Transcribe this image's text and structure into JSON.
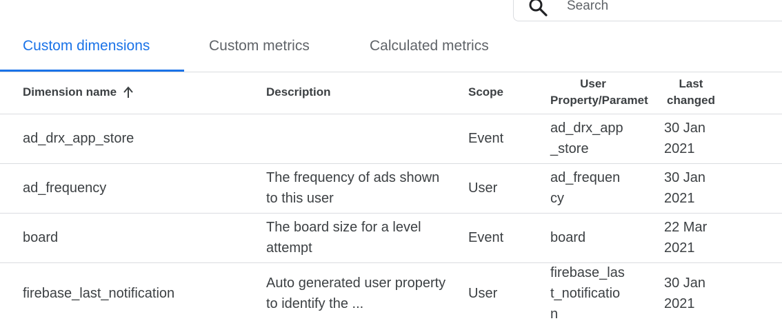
{
  "search": {
    "placeholder": "Search",
    "icon": "search-icon"
  },
  "colors": {
    "accent": "#1a73e8",
    "text": "#3c4043",
    "muted": "#5f6368",
    "divider": "#dadce0"
  },
  "tabs": [
    {
      "label": "Custom dimensions",
      "active": true
    },
    {
      "label": "Custom metrics",
      "active": false
    },
    {
      "label": "Calculated metrics",
      "active": false
    }
  ],
  "table": {
    "headers": {
      "name": "Dimension name",
      "sort_icon": "arrow-up-icon",
      "description": "Description",
      "scope": "Scope",
      "param_line1": "User",
      "param_line2": "Property/Parameter",
      "changed_line1": "Last",
      "changed_line2": "changed"
    },
    "rows": [
      {
        "name": "ad_drx_app_store",
        "description": "",
        "scope": "Event",
        "param": "ad_drx_app_store",
        "changed": "30 Jan 2021"
      },
      {
        "name": "ad_frequency",
        "description": "The frequency of ads shown to this user",
        "scope": "User",
        "param": "ad_frequency",
        "changed": "30 Jan 2021"
      },
      {
        "name": "board",
        "description": "The board size for a level attempt",
        "scope": "Event",
        "param": "board",
        "changed": "22 Mar 2021"
      },
      {
        "name": "firebase_last_notification",
        "description": "Auto generated user property to identify the ...",
        "scope": "User",
        "param": "firebase_last_notification",
        "changed": "30 Jan 2021"
      }
    ]
  }
}
